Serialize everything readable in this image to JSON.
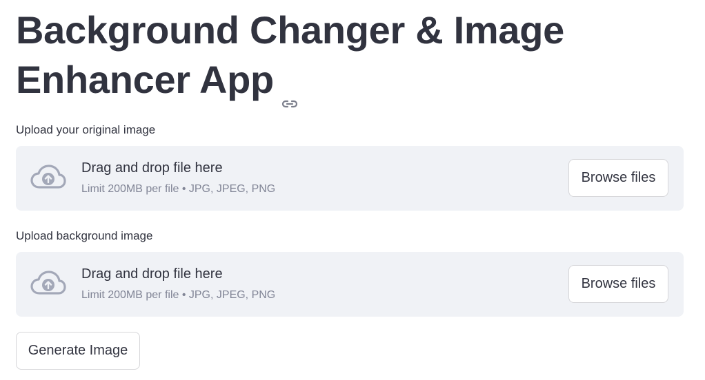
{
  "header": {
    "title": "Background Changer & Image Enhancer App",
    "anchor_icon": "link-icon"
  },
  "uploaders": [
    {
      "label": "Upload your original image",
      "drop_text": "Drag and drop file here",
      "limit_text": "Limit 200MB per file • JPG, JPEG, PNG",
      "browse_label": "Browse files",
      "icon": "cloud-upload-icon"
    },
    {
      "label": "Upload background image",
      "drop_text": "Drag and drop file here",
      "limit_text": "Limit 200MB per file • JPG, JPEG, PNG",
      "browse_label": "Browse files",
      "icon": "cloud-upload-icon"
    }
  ],
  "actions": {
    "generate_label": "Generate Image"
  },
  "colors": {
    "text": "#31333f",
    "muted": "#808495",
    "dropzone_bg": "#f0f2f6",
    "icon": "#a3a8b8"
  }
}
